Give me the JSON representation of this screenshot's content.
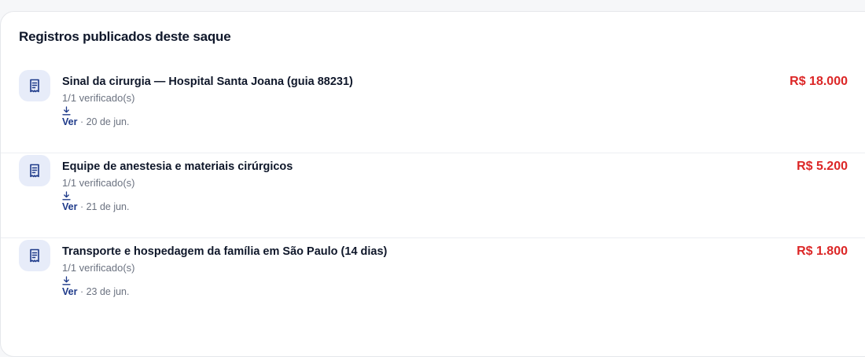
{
  "section": {
    "title": "Registros publicados deste saque"
  },
  "colors": {
    "amount": "#dc2626",
    "link": "#1e3a8a",
    "icon_bg": "#e7ecf9"
  },
  "records": [
    {
      "icon": "receipt-icon",
      "title": "Sinal da cirurgia — Hospital Santa Joana (guia 88231)",
      "verified": "1/1 verificado(s)",
      "link_label": "Ver",
      "separator": " · ",
      "date": "20 de jun.",
      "amount": "R$ 18.000"
    },
    {
      "icon": "receipt-icon",
      "title": "Equipe de anestesia e materiais cirúrgicos",
      "verified": "1/1 verificado(s)",
      "link_label": "Ver",
      "separator": " · ",
      "date": "21 de jun.",
      "amount": "R$ 5.200"
    },
    {
      "icon": "receipt-icon",
      "title": "Transporte e hospedagem da família em São Paulo (14 dias)",
      "verified": "1/1 verificado(s)",
      "link_label": "Ver",
      "separator": " · ",
      "date": "23 de jun.",
      "amount": "R$ 1.800"
    }
  ]
}
